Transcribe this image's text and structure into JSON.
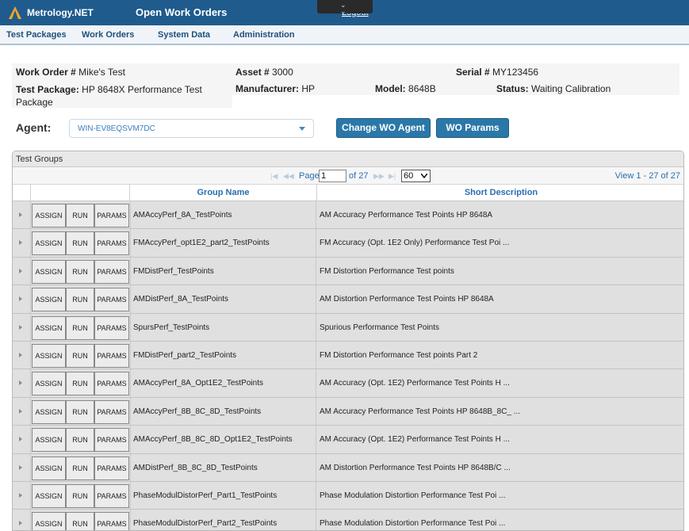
{
  "app": {
    "brand": "Metrology.NET",
    "page_title": "Open Work Orders",
    "logout": "Logout"
  },
  "nav": {
    "items": [
      "Test Packages",
      "Work Orders",
      "System Data",
      "Administration"
    ]
  },
  "info": {
    "work_order_label": "Work Order #",
    "work_order_value": "Mike's Test",
    "asset_label": "Asset #",
    "asset_value": "3000",
    "serial_label": "Serial #",
    "serial_value": "MY123456",
    "test_package_label": "Test Package:",
    "test_package_value": "HP 8648X Performance Test",
    "test_package_value_line2": "Package",
    "manufacturer_label": "Manufacturer:",
    "manufacturer_value": "HP",
    "model_label": "Model:",
    "model_value": "8648B",
    "status_label": "Status:",
    "status_value": "Waiting Calibration"
  },
  "agent": {
    "label": "Agent:",
    "selected": "WIN-EV8EQSVM7DC",
    "change_button": "Change WO Agent",
    "params_button": "WO Params"
  },
  "grid": {
    "caption": "Test Groups",
    "pager": {
      "page_label": "Page",
      "page_value": "1",
      "of_label": "of 27",
      "page_size": "60",
      "view_label": "View 1 - 27 of 27"
    },
    "columns": [
      "Group Name",
      "Short Description"
    ],
    "row_buttons": [
      "ASSIGN",
      "RUN",
      "PARAMS"
    ],
    "rows": [
      {
        "name": "AMAccyPerf_8A_TestPoints",
        "desc": "AM Accuracy Performance Test Points HP 8648A"
      },
      {
        "name": "FMAccyPerf_opt1E2_part2_TestPoints",
        "desc": "FM Accuracy (Opt. 1E2 Only) Performance Test Poi ..."
      },
      {
        "name": "FMDistPerf_TestPoints",
        "desc": "FM Distortion Performance Test points"
      },
      {
        "name": "AMDistPerf_8A_TestPoints",
        "desc": "AM Distortion Performance Test Points HP 8648A"
      },
      {
        "name": "SpursPerf_TestPoints",
        "desc": "Spurious Performance Test Points"
      },
      {
        "name": "FMDistPerf_part2_TestPoints",
        "desc": "FM Distortion Performance Test points Part 2"
      },
      {
        "name": "AMAccyPerf_8A_Opt1E2_TestPoints",
        "desc": "AM Accuracy (Opt. 1E2) Performance Test Points H ..."
      },
      {
        "name": "AMAccyPerf_8B_8C_8D_TestPoints",
        "desc": "AM Accuracy Performance Test Points HP 8648B_8C_ ..."
      },
      {
        "name": "AMAccyPerf_8B_8C_8D_Opt1E2_TestPoints",
        "desc": "AM Accuracy (Opt. 1E2) Performance Test Points H ..."
      },
      {
        "name": "AMDistPerf_8B_8C_8D_TestPoints",
        "desc": "AM Distortion Performance Test Points HP 8648B/C ..."
      },
      {
        "name": "PhaseModulDistorPerf_Part1_TestPoints",
        "desc": "Phase Modulation Distortion Performance Test Poi ..."
      },
      {
        "name": "PhaseModulDistorPerf_Part2_TestPoints",
        "desc": "Phase Modulation Distortion Performance Test Poi ..."
      }
    ]
  },
  "colors": {
    "header_bg": "#1f5b8d",
    "button_bg": "#2b78a8",
    "link": "#2a6fb0"
  }
}
